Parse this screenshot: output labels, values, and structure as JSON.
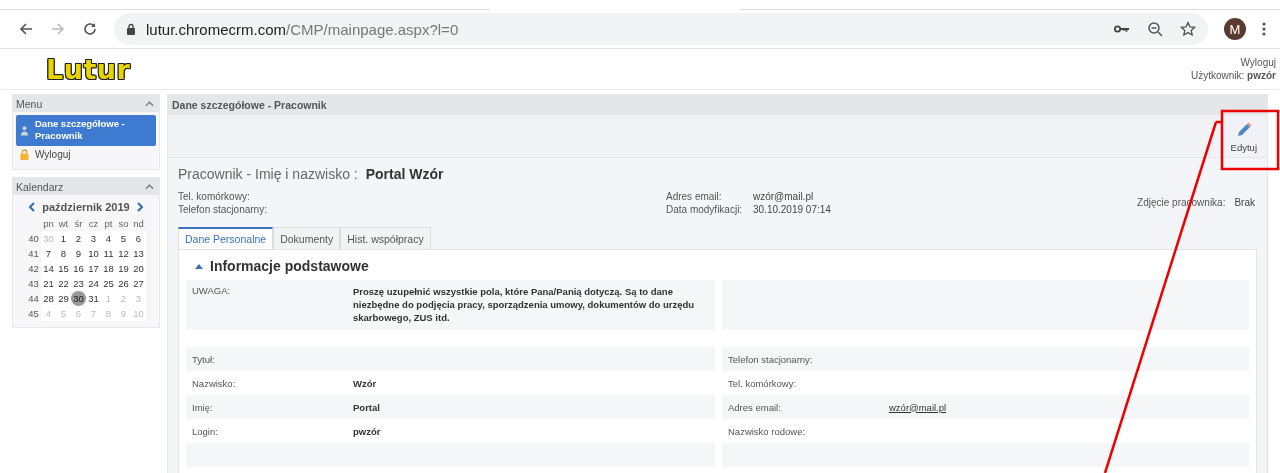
{
  "browser": {
    "url_host": "lutur.chromecrm.com",
    "url_path": "/CMP/mainpage.aspx?l=0",
    "avatar": "M"
  },
  "header": {
    "logo": "Lutur",
    "logout": "Wyloguj",
    "user_label": "Użytkownik:",
    "user": "pwzór"
  },
  "sidebar": {
    "menu": {
      "title": "Menu",
      "expanded": true,
      "items": [
        {
          "label": "Dane szczegółowe - Pracownik",
          "kind": "employee",
          "selected": true
        },
        {
          "label": "Wyloguj",
          "kind": "logout",
          "selected": false
        }
      ]
    },
    "calendar": {
      "title": "Kalendarz",
      "expanded": true,
      "month": "październik 2019",
      "weekdays": [
        "pn",
        "wt",
        "śr",
        "cz",
        "pt",
        "so",
        "nd"
      ],
      "weeks": [
        {
          "number": "40",
          "days": [
            {
              "d": "30",
              "other": true,
              "selected": false
            },
            {
              "d": "1",
              "other": false,
              "selected": false
            },
            {
              "d": "2",
              "other": false,
              "selected": false
            },
            {
              "d": "3",
              "other": false,
              "selected": false
            },
            {
              "d": "4",
              "other": false,
              "selected": false
            },
            {
              "d": "5",
              "other": false,
              "selected": false
            },
            {
              "d": "6",
              "other": false,
              "selected": false
            }
          ]
        },
        {
          "number": "41",
          "days": [
            {
              "d": "7",
              "other": false,
              "selected": false
            },
            {
              "d": "8",
              "other": false,
              "selected": false
            },
            {
              "d": "9",
              "other": false,
              "selected": false
            },
            {
              "d": "10",
              "other": false,
              "selected": false
            },
            {
              "d": "11",
              "other": false,
              "selected": false
            },
            {
              "d": "12",
              "other": false,
              "selected": false
            },
            {
              "d": "13",
              "other": false,
              "selected": false
            }
          ]
        },
        {
          "number": "42",
          "days": [
            {
              "d": "14",
              "other": false,
              "selected": false
            },
            {
              "d": "15",
              "other": false,
              "selected": false
            },
            {
              "d": "16",
              "other": false,
              "selected": false
            },
            {
              "d": "17",
              "other": false,
              "selected": false
            },
            {
              "d": "18",
              "other": false,
              "selected": false
            },
            {
              "d": "19",
              "other": false,
              "selected": false
            },
            {
              "d": "20",
              "other": false,
              "selected": false
            }
          ]
        },
        {
          "number": "43",
          "days": [
            {
              "d": "21",
              "other": false,
              "selected": false
            },
            {
              "d": "22",
              "other": false,
              "selected": false
            },
            {
              "d": "23",
              "other": false,
              "selected": false
            },
            {
              "d": "24",
              "other": false,
              "selected": false
            },
            {
              "d": "25",
              "other": false,
              "selected": false
            },
            {
              "d": "26",
              "other": false,
              "selected": false
            },
            {
              "d": "27",
              "other": false,
              "selected": false
            }
          ]
        },
        {
          "number": "44",
          "days": [
            {
              "d": "28",
              "other": false,
              "selected": false
            },
            {
              "d": "29",
              "other": false,
              "selected": false
            },
            {
              "d": "30",
              "other": false,
              "selected": true
            },
            {
              "d": "31",
              "other": false,
              "selected": false
            },
            {
              "d": "1",
              "other": true,
              "selected": false
            },
            {
              "d": "2",
              "other": true,
              "selected": false
            },
            {
              "d": "3",
              "other": true,
              "selected": false
            }
          ]
        },
        {
          "number": "45",
          "days": [
            {
              "d": "4",
              "other": true,
              "selected": false
            },
            {
              "d": "5",
              "other": true,
              "selected": false
            },
            {
              "d": "6",
              "other": true,
              "selected": false
            },
            {
              "d": "7",
              "other": true,
              "selected": false
            },
            {
              "d": "8",
              "other": true,
              "selected": false
            },
            {
              "d": "9",
              "other": true,
              "selected": false
            },
            {
              "d": "10",
              "other": true,
              "selected": false
            }
          ]
        }
      ]
    }
  },
  "main": {
    "title": "Dane szczegółowe - Pracownik",
    "edit_button": "Edytuj",
    "heading_label": "Pracownik - Imię i nazwisko :",
    "heading_value": "Portal Wzór",
    "info_left": [
      {
        "label": "Tel. komórkowy:"
      },
      {
        "label": "Telefon stacjonarny:"
      }
    ],
    "info_middle": [
      {
        "label": "Adres email:",
        "value": "wzór@mail.pl"
      },
      {
        "label": "Data modyfikacji:",
        "value": "30.10.2019 07:14"
      }
    ],
    "photo": {
      "label": "Zdjęcie pracownika:",
      "value": "Brak"
    },
    "tabs": [
      {
        "label": "Dane Personalne",
        "selected": true
      },
      {
        "label": "Dokumenty",
        "selected": false
      },
      {
        "label": "Hist. współpracy",
        "selected": false
      }
    ],
    "section": {
      "title": "Informacje podstawowe",
      "expanded": true,
      "notice": {
        "label": "UWAGA:",
        "text": "Proszę uzupełnić wszystkie pola, które Pana/Panią dotyczą. Są to dane niezbędne do podjęcia pracy, sporządzenia umowy, dokumentów do urzędu skarbowego, ZUS itd."
      },
      "fields_left": [
        {
          "label": "Tytuł:"
        },
        {
          "label": "Nazwisko:",
          "value": "Wzór",
          "link": false
        },
        {
          "label": "Imię:",
          "value": "Portal",
          "link": false
        },
        {
          "label": "Login:",
          "value": "pwzór",
          "link": false
        }
      ],
      "fields_right": [
        {
          "label": "Telefon stacjonarny:"
        },
        {
          "label": "Tel. komórkowy:"
        },
        {
          "label": "Adres email:",
          "value": "wzór@mail.pl",
          "link": true
        },
        {
          "label": "Nazwisko rodowe:"
        }
      ]
    }
  }
}
